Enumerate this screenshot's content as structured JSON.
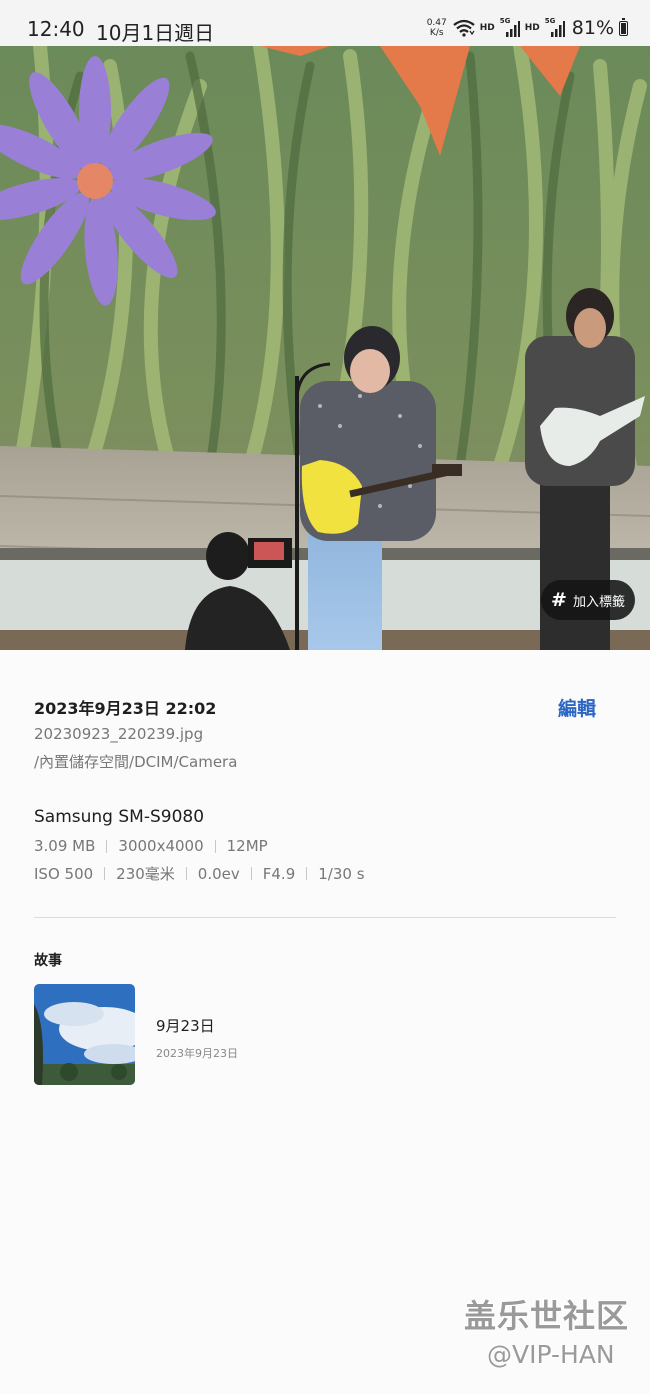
{
  "status_bar": {
    "time": "12:40",
    "date": "10月1日週日",
    "net_speed_value": "0.47",
    "net_speed_unit": "K/s",
    "hd_label_1": "HD",
    "hd_label_2": "HD",
    "signal_label_1": "5G",
    "signal_label_2": "5G",
    "battery": "81%"
  },
  "photo": {
    "tag_button_label": "加入標籤",
    "tag_button_icon": "hash-icon"
  },
  "details": {
    "datetime": "2023年9月23日 22:02",
    "edit_label": "編輯",
    "filename": "20230923_220239.jpg",
    "path": "/內置儲存空間/DCIM/Camera",
    "device": "Samsung SM-S9080",
    "file_size": "3.09 MB",
    "resolution": "3000x4000",
    "megapixels": "12MP",
    "iso": "ISO 500",
    "focal_length": "230毫米",
    "exposure_bias": "0.0ev",
    "aperture": "F4.9",
    "shutter": "1/30 s"
  },
  "stories": {
    "heading": "故事",
    "items": [
      {
        "title": "9月23日",
        "date": "2023年9月23日"
      }
    ]
  },
  "watermark": {
    "line1": "盖乐世社区",
    "line2": "@VIP-HAN"
  },
  "colors": {
    "accent": "#2a66c4",
    "background": "#fbfbfb",
    "tag_button_bg": "#141414"
  }
}
